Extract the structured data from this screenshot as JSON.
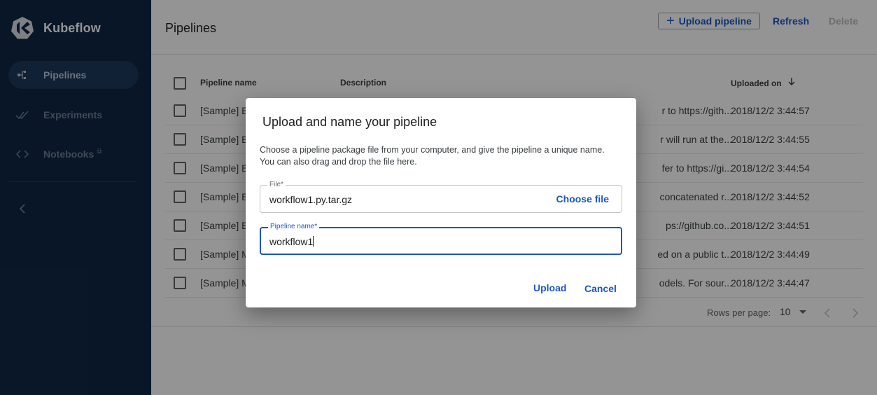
{
  "app": {
    "brand": "Kubeflow"
  },
  "sidebar": {
    "items": [
      {
        "label": "Pipelines",
        "icon": "pipelines-icon",
        "active": true
      },
      {
        "label": "Experiments",
        "icon": "experiments-icon",
        "active": false
      },
      {
        "label": "Notebooks",
        "icon": "code-icon",
        "active": false,
        "external_marker": "⧉"
      }
    ],
    "collapse_icon": "chevron-left-icon"
  },
  "toolbar": {
    "title": "Pipelines",
    "upload_label": "Upload pipeline",
    "refresh_label": "Refresh",
    "delete_label": "Delete"
  },
  "table": {
    "columns": [
      "Pipeline name",
      "Description",
      "Uploaded on"
    ],
    "sort_icon": "arrow-down-icon",
    "rows": [
      {
        "name": "[Sample] B",
        "description": "r to https://gith...",
        "uploaded_on": "2018/12/2 3:44:57"
      },
      {
        "name": "[Sample] B",
        "description": "r will run at the...",
        "uploaded_on": "2018/12/2 3:44:55"
      },
      {
        "name": "[Sample] B",
        "description": "fer to https://gi...",
        "uploaded_on": "2018/12/2 3:44:54"
      },
      {
        "name": "[Sample] B",
        "description": "concatenated r...",
        "uploaded_on": "2018/12/2 3:44:52"
      },
      {
        "name": "[Sample] B",
        "description": "ps://github.co...",
        "uploaded_on": "2018/12/2 3:44:51"
      },
      {
        "name": "[Sample] M",
        "description": "ed on a public t...",
        "uploaded_on": "2018/12/2 3:44:49"
      },
      {
        "name": "[Sample] M",
        "description": "odels. For sour...",
        "uploaded_on": "2018/12/2 3:44:47"
      }
    ]
  },
  "pagination": {
    "rows_per_page_label": "Rows per page:",
    "rows_per_page_value": "10"
  },
  "dialog": {
    "title": "Upload and name your pipeline",
    "description_line1": "Choose a pipeline package file from your computer, and give the pipeline a unique name.",
    "description_line2": "You can also drag and drop the file here.",
    "file_label": "File*",
    "file_value": "workflow1.py.tar.gz",
    "choose_file_label": "Choose file",
    "name_label": "Pipeline name*",
    "name_value": "workflow1",
    "upload_label": "Upload",
    "cancel_label": "Cancel"
  },
  "colors": {
    "sidebar_bg": "#0f2745",
    "accent": "#1a56c6"
  }
}
